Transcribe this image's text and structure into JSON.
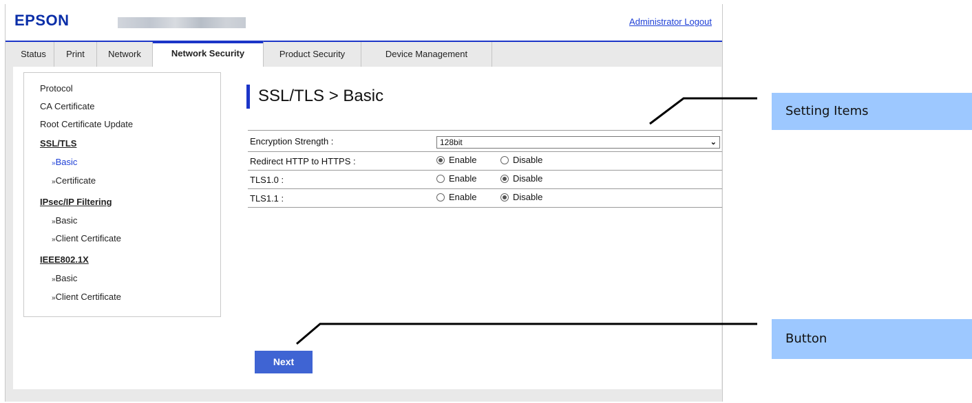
{
  "header": {
    "brand": "EPSON",
    "logout_label": "Administrator Logout"
  },
  "tabs": [
    {
      "label": "Status",
      "active": false
    },
    {
      "label": "Print",
      "active": false
    },
    {
      "label": "Network",
      "active": false
    },
    {
      "label": "Network Security",
      "active": true
    },
    {
      "label": "Product Security",
      "active": false
    },
    {
      "label": "Device Management",
      "active": false
    }
  ],
  "menu": {
    "protocol": "Protocol",
    "ca_certificate": "CA Certificate",
    "root_cert_update": "Root Certificate Update",
    "ssl_tls": "SSL/TLS",
    "ssl_basic": "Basic",
    "ssl_certificate": "Certificate",
    "ipsec": "IPsec/IP Filtering",
    "ipsec_basic": "Basic",
    "ipsec_client_cert": "Client Certificate",
    "ieee": "IEEE802.1X",
    "ieee_basic": "Basic",
    "ieee_client_cert": "Client Certificate",
    "sub_prefix": "»"
  },
  "main": {
    "title": "SSL/TLS > Basic",
    "encryption_strength": {
      "label": "Encryption Strength :",
      "value": "128bit"
    },
    "redirect_https": {
      "label": "Redirect HTTP to HTTPS :",
      "enable": "Enable",
      "disable": "Disable",
      "selected": "Enable"
    },
    "tls10": {
      "label": "TLS1.0 :",
      "enable": "Enable",
      "disable": "Disable",
      "selected": "Disable"
    },
    "tls11": {
      "label": "TLS1.1 :",
      "enable": "Enable",
      "disable": "Disable",
      "selected": "Disable"
    },
    "next_label": "Next"
  },
  "callouts": {
    "setting_items": "Setting Items",
    "button": "Button"
  },
  "colors": {
    "accent": "#1b35c8",
    "button": "#3f64d3",
    "callout": "#9dc8ff"
  }
}
